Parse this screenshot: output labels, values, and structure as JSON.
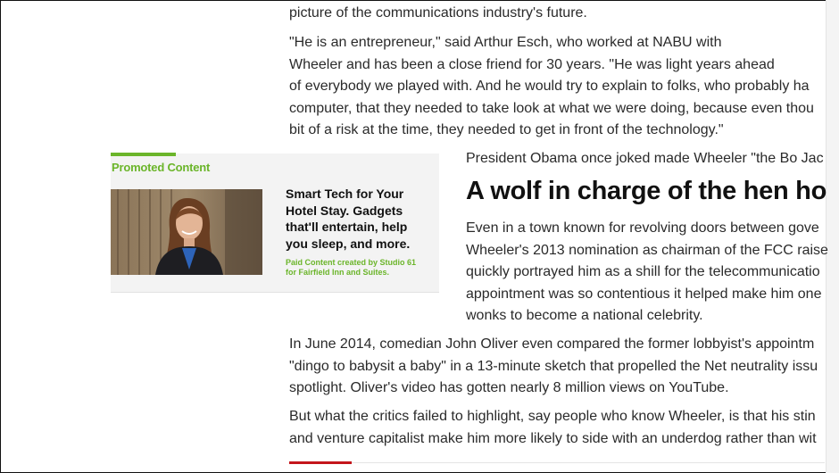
{
  "article": {
    "p1": [
      "picture of the communications industry's future."
    ],
    "p2": [
      "\"He is an entrepreneur,\" said Arthur Esch, who worked at NABU with",
      "Wheeler and has been a close friend for 30 years. \"He was light years ahead",
      "of everybody we played with. And he would try to explain to folks, who probably ha",
      "computer, that they needed to take look at what we were doing, because even thou",
      "bit of a risk at the time, they needed to get in front of the technology.\""
    ],
    "p3": [
      "President Obama once joked made Wheeler \"the Bo Jac"
    ],
    "heading": "A wolf in charge of the hen ho",
    "p4": [
      "Even in a town known for revolving doors between gove",
      "Wheeler's 2013 nomination as chairman of the FCC raise",
      "quickly portrayed him as a shill for the telecommunicatio",
      "appointment was so contentious it helped make him one",
      "wonks to become a national celebrity."
    ],
    "p5": [
      "In June 2014, comedian John Oliver even compared the former lobbyist's appointm",
      "\"dingo to babysit a baby\" in a 13-minute sketch that propelled the Net neutrality issu",
      "spotlight. Oliver's video has gotten nearly 8 million views on YouTube."
    ],
    "p6": [
      "But what the critics failed to highlight, say people who know Wheeler, is that his stin",
      "and venture capitalist make him more likely to side with an underdog rather than wit"
    ]
  },
  "promo": {
    "label": "Promoted Content",
    "headline": [
      "Smart Tech for Your",
      "Hotel Stay. Gadgets",
      "that'll entertain, help",
      "you sleep, and more."
    ],
    "sponsor": [
      "Paid Content created by Studio 61",
      "for Fairfield Inn and Suites."
    ],
    "accent_color": "#6bb52a"
  },
  "colors": {
    "divider_accent": "#c4161c"
  }
}
